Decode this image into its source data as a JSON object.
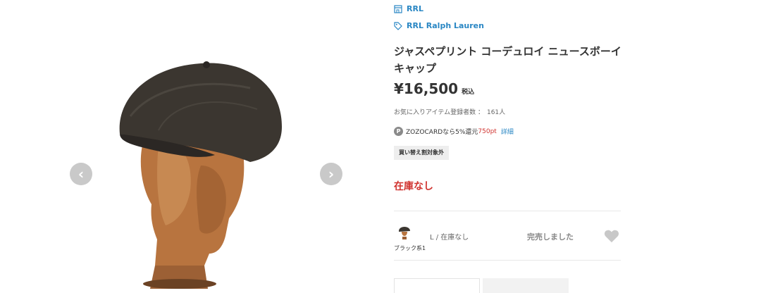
{
  "links": {
    "brand": "RRL",
    "designer": "RRL Ralph Lauren"
  },
  "product": {
    "name": "ジャスペプリント コーデュロイ ニュースボーイキャップ",
    "price": "¥16,500",
    "tax_label": "税込",
    "favorites_label": "お気に入りアイテム登録者数 ：",
    "favorites_count": "161人",
    "points_badge": "P",
    "points_text": "ZOZOCARDなら5%還元",
    "points_value": "750pt",
    "points_detail": "詳細",
    "tag": "買い替え割対象外",
    "stock_status": "在庫なし"
  },
  "variant": {
    "color": "ブラック系1",
    "size_stock": "L / 在庫なし",
    "status": "完売しました"
  },
  "carousel": {
    "prev_icon": "‹",
    "next_icon": "›"
  },
  "colors": {
    "link": "#2a87c4",
    "alert": "#d0332f"
  },
  "icons": [
    "store-icon",
    "tag-icon",
    "chevron-left-icon",
    "chevron-right-icon",
    "heart-icon"
  ]
}
